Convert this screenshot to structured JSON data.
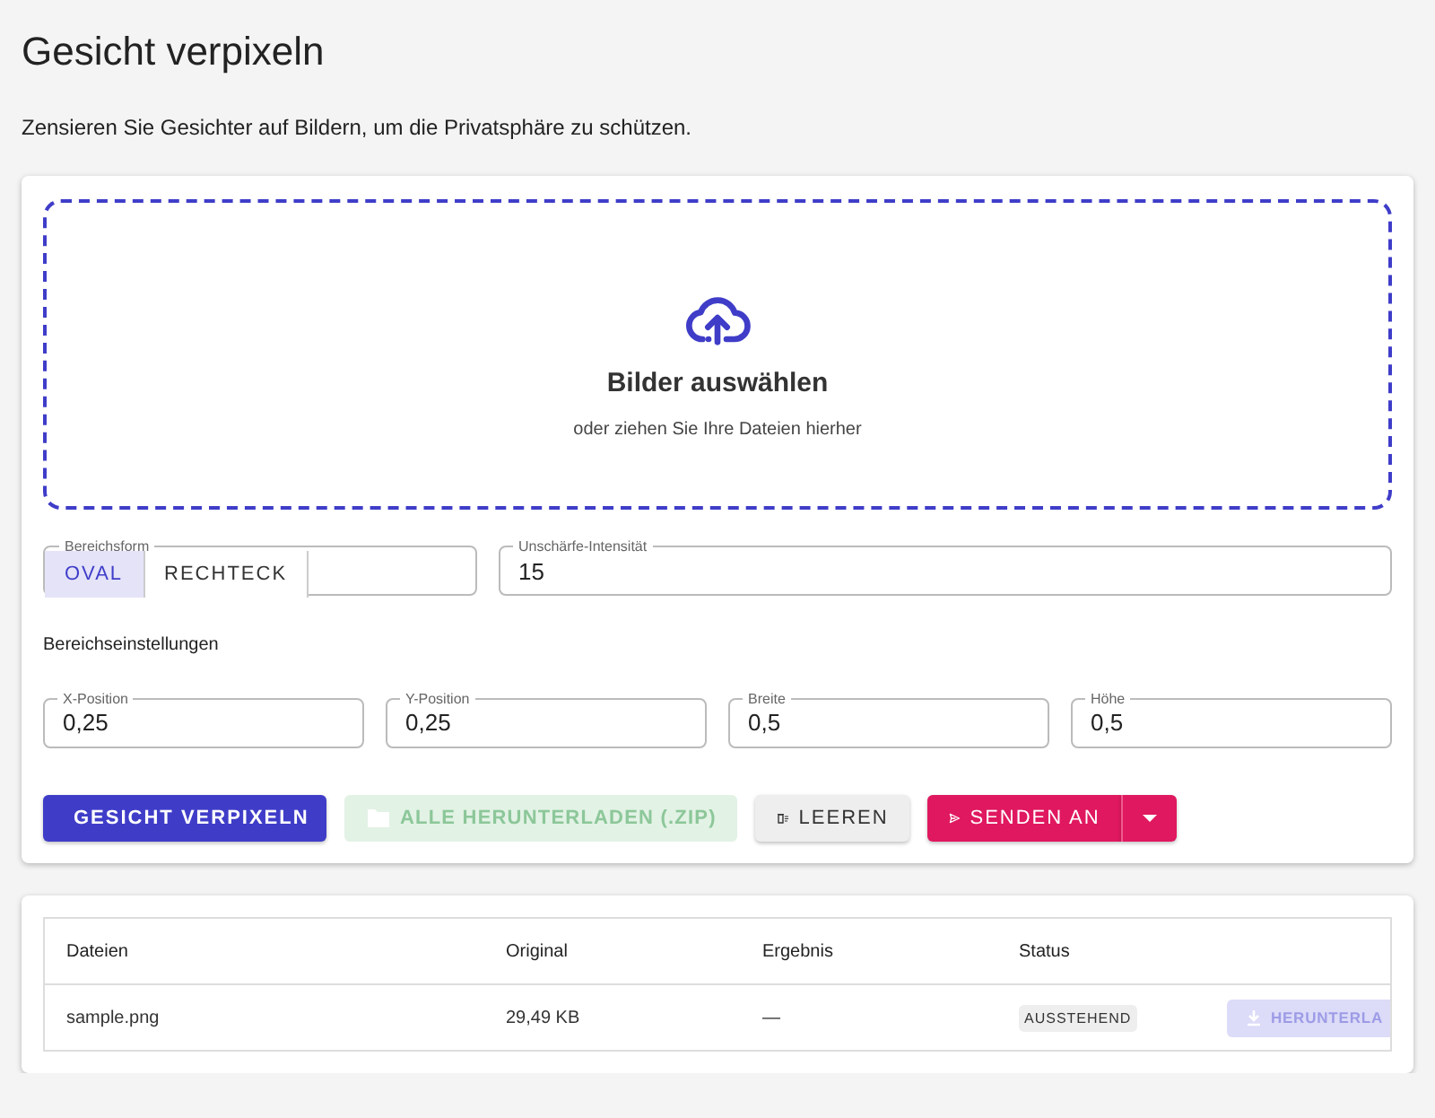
{
  "page": {
    "title": "Gesicht verpixeln",
    "subtitle": "Zensieren Sie Gesichter auf Bildern, um die Privatsphäre zu schützen."
  },
  "dropzone": {
    "title": "Bilder auswählen",
    "hint": "oder ziehen Sie Ihre Dateien hierher"
  },
  "shape": {
    "label": "Bereichsform",
    "options": [
      {
        "label": "OVAL",
        "selected": true
      },
      {
        "label": "RECHTECK",
        "selected": false
      }
    ]
  },
  "blur": {
    "label": "Unschärfe-Intensität",
    "value": "15"
  },
  "section_title": "Bereichseinstellungen",
  "position_fields": [
    {
      "label": "X-Position",
      "value": "0,25"
    },
    {
      "label": "Y-Position",
      "value": "0,25"
    },
    {
      "label": "Breite",
      "value": "0,5"
    },
    {
      "label": "Höhe",
      "value": "0,5"
    }
  ],
  "buttons": [
    {
      "kind": "pixelate",
      "label": "GESICHT VERPIXELN",
      "disabled": false
    },
    {
      "kind": "download",
      "label": "ALLE HERUNTERLADEN (.ZIP)",
      "disabled": true
    },
    {
      "kind": "clear",
      "label": "LEEREN",
      "disabled": false
    },
    {
      "kind": "send",
      "label": "SENDEN AN",
      "disabled": false
    }
  ],
  "table": {
    "columns": [
      "Dateien",
      "Original",
      "Ergebnis",
      "Status"
    ],
    "rows": [
      {
        "file": "sample.png",
        "original": "29,49 KB",
        "result": "—",
        "status": "AUSSTEHEND",
        "action": {
          "label": "HERUNTERLA",
          "disabled": true
        }
      }
    ]
  }
}
